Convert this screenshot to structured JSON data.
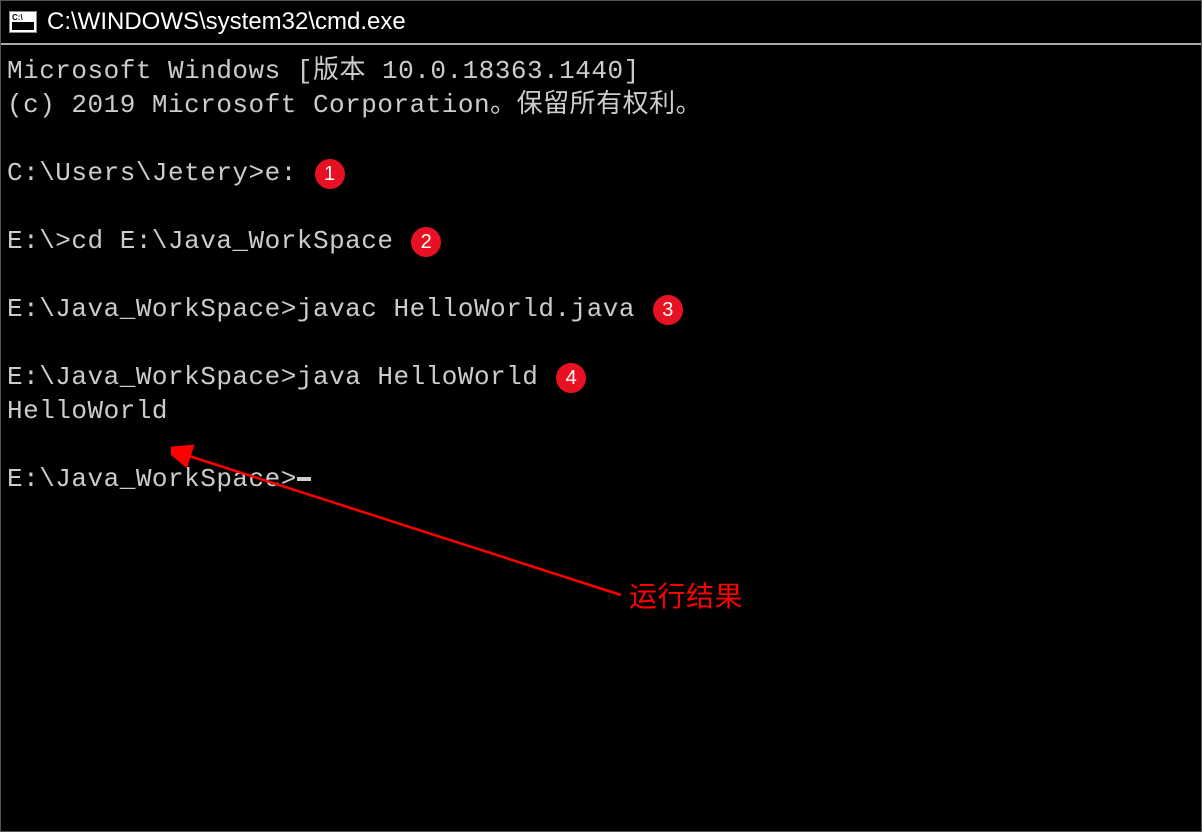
{
  "window": {
    "title": "C:\\WINDOWS\\system32\\cmd.exe"
  },
  "terminal": {
    "line1": "Microsoft Windows [版本 10.0.18363.1440]",
    "line2": "(c) 2019 Microsoft Corporation。保留所有权利。",
    "prompts": [
      {
        "prompt": "C:\\Users\\Jetery>",
        "command": "e:",
        "badge": "1"
      },
      {
        "prompt": "E:\\>",
        "command": "cd E:\\Java_WorkSpace",
        "badge": "2"
      },
      {
        "prompt": "E:\\Java_WorkSpace>",
        "command": "javac HelloWorld.java",
        "badge": "3"
      },
      {
        "prompt": "E:\\Java_WorkSpace>",
        "command": "java HelloWorld",
        "badge": "4"
      }
    ],
    "output": "HelloWorld",
    "final_prompt": "E:\\Java_WorkSpace>"
  },
  "annotation": {
    "label": "运行结果",
    "arrow_color": "#ff0000"
  }
}
